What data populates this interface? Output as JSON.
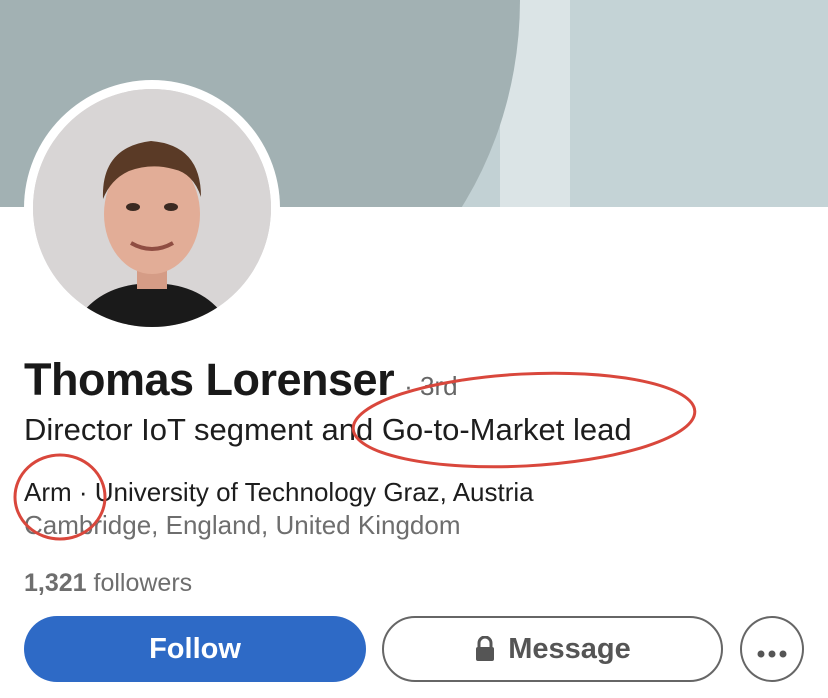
{
  "profile": {
    "name": "Thomas Lorenser",
    "degree": "· 3rd",
    "headline": "Director IoT segment and Go-to-Market lead",
    "company": "Arm",
    "separator": " · ",
    "education": "University of Technology Graz, Austria",
    "location": "Cambridge, England, United Kingdom",
    "followers_count": "1,321",
    "followers_label": " followers"
  },
  "actions": {
    "follow_label": "Follow",
    "message_label": "Message",
    "more_icon": "ellipsis-icon",
    "message_icon": "lock-icon"
  },
  "colors": {
    "follow_bg": "#2e6ac6",
    "annotation": "#d9473c"
  }
}
